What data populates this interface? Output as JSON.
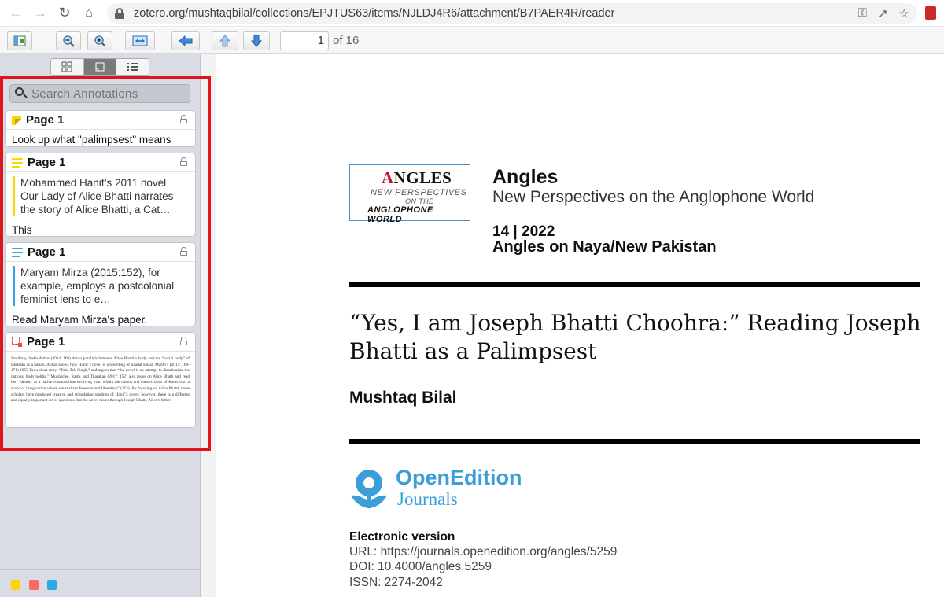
{
  "browser": {
    "url": "zotero.org/mushtaqbilal/collections/EPJTUS63/items/NJLDJ4R6/attachment/B7PAER4R/reader"
  },
  "toolbar": {
    "page_number": "1",
    "page_total": "of 16"
  },
  "sidebar": {
    "search_placeholder": "Search Annotations",
    "annotations": [
      {
        "type": "note",
        "color": "#ffd400",
        "page": "Page 1",
        "text": "Look up what \"palimpsest\" means"
      },
      {
        "type": "highlight",
        "color": "#ffd400",
        "page": "Page 1",
        "quote_lines": [
          "Mohammed Hanif’s 2011 novel",
          "Our Lady of Alice Bhatti narrates",
          "the story of Alice Bhatti, a Cat…"
        ],
        "comment": "This"
      },
      {
        "type": "highlight",
        "color": "#2ea8e5",
        "page": "Page 1",
        "quote_lines": [
          "Maryam Mirza (2015:152), for",
          "example, employs a postcolonial",
          "feminist lens to e…"
        ],
        "comment": "Read Maryam Mirza's paper."
      },
      {
        "type": "image",
        "color": "#e34f4f",
        "page": "Page 1",
        "snippet": "Similarly, Sadia Abbas (2014: 169) draws parallels between Alice Bhatti’s body and the “social body” of Pakistan as a nation. Abbas shows how Hanif’s novel is a rewriting of Saadat Hasan Manto’s (2015: 169-171) 1955 Urdu short story, “Toba Tek Singh,” and argues that “the novel is an attempt to disarticulate the national body politic.” Mukherjee, Raith, and Tharakan (2017: 152) also focus on Alice Bhatti and read her “identity as a native cosmopolitan evolving from within the taboos and constrictions of Karachi to a space of imagination where she realizes freedom and liberation” (152). By focusing on Alice Bhatti, these scholars have produced creative and stimulating readings of Hanif’s novel; however, there is a different and equally important set of questions that the novel raises through Joseph Bhatti, Alice’s father."
      }
    ],
    "filter_colors": [
      "#ffd400",
      "#ff6666",
      "#2ea8e5"
    ]
  },
  "document": {
    "logo": {
      "big_first": "A",
      "big_rest": "NGLES",
      "line1": "NEW PERSPECTIVES",
      "line2": "ON THE",
      "line3": "ANGLOPHONE WORLD"
    },
    "journal_title": "Angles",
    "journal_subtitle": "New Perspectives on the Anglophone World",
    "issue": "14 | 2022",
    "theme": "Angles on Naya/New Pakistan",
    "article_title": "“Yes, I am Joseph Bhatti Choohra:” Reading Joseph Bhatti as a Palimpsest",
    "author": "Mushtaq Bilal",
    "publisher_name": "OpenEdition",
    "publisher_sub": "Journals",
    "ev_heading": "Electronic version",
    "ev_url": "URL: https://journals.openedition.org/angles/5259",
    "ev_doi": "DOI: 10.4000/angles.5259",
    "ev_issn": "ISSN: 2274-2042"
  }
}
